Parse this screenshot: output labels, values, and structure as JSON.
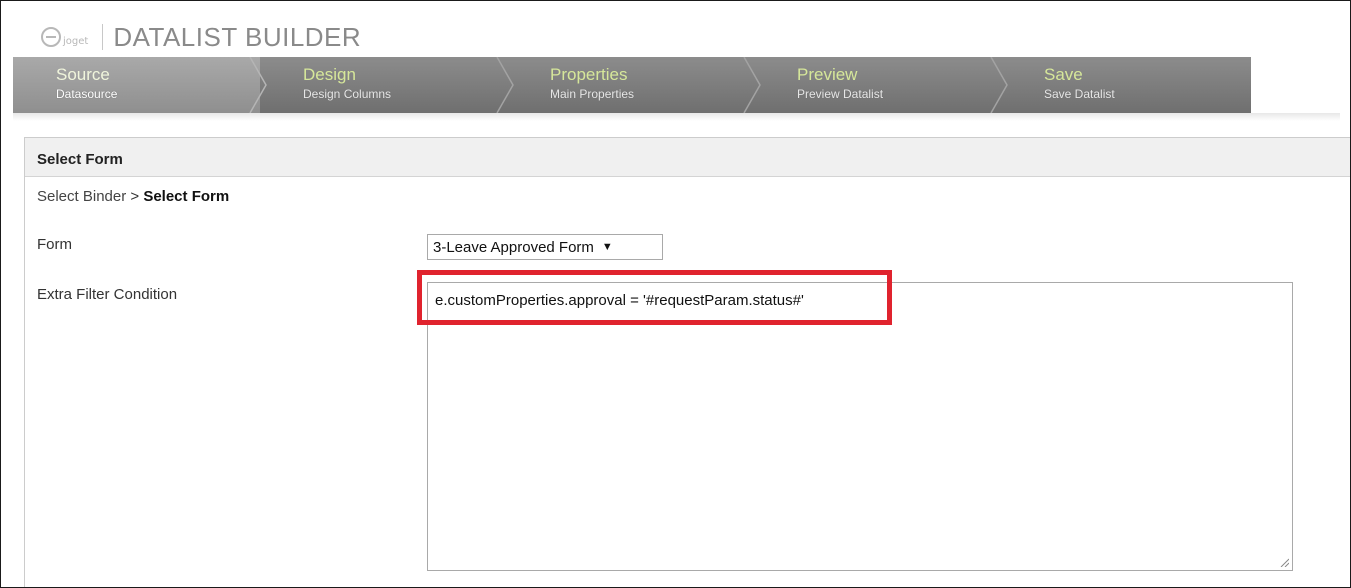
{
  "header": {
    "logo_text": "joget",
    "title": "DATALIST BUILDER"
  },
  "steps": [
    {
      "title": "Source",
      "subtitle": "Datasource"
    },
    {
      "title": "Design",
      "subtitle": "Design Columns"
    },
    {
      "title": "Properties",
      "subtitle": "Main Properties"
    },
    {
      "title": "Preview",
      "subtitle": "Preview Datalist"
    },
    {
      "title": "Save",
      "subtitle": "Save Datalist"
    }
  ],
  "panel": {
    "title": "Select Form",
    "breadcrumb": {
      "parent": "Select Binder",
      "separator": " > ",
      "current": "Select Form"
    },
    "form_label": "Form",
    "form_value": "3-Leave Approved Form",
    "filter_label": "Extra Filter Condition",
    "filter_value": "e.customProperties.approval = '#requestParam.status#'"
  },
  "colors": {
    "highlight": "#e0232e",
    "step_title": "#d6e79a",
    "step_bar": "#7d7d7d"
  }
}
